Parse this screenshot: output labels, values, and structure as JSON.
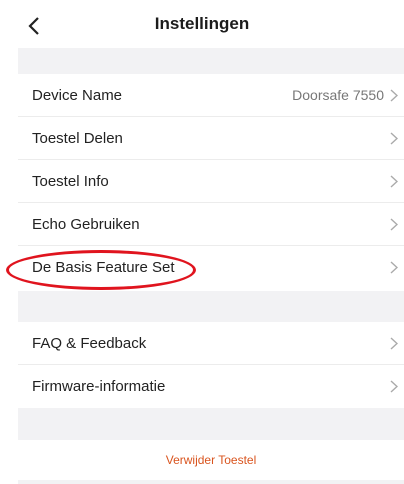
{
  "header": {
    "title": "Instellingen",
    "back_icon": "chevron-left-icon"
  },
  "settings": [
    {
      "label": "Device Name",
      "value": "Doorsafe 7550"
    },
    {
      "label": "Toestel Delen"
    },
    {
      "label": "Toestel Info"
    },
    {
      "label": "Echo Gebruiken"
    },
    {
      "label": "De Basis Feature Set"
    }
  ],
  "support": [
    {
      "label": "FAQ & Feedback"
    },
    {
      "label": "Firmware-informatie"
    }
  ],
  "remove_label": "Verwijder Toestel",
  "colors": {
    "section_gap": "#f2f2f4",
    "remove_text": "#d9541e",
    "highlight_ring": "#e0141e"
  }
}
